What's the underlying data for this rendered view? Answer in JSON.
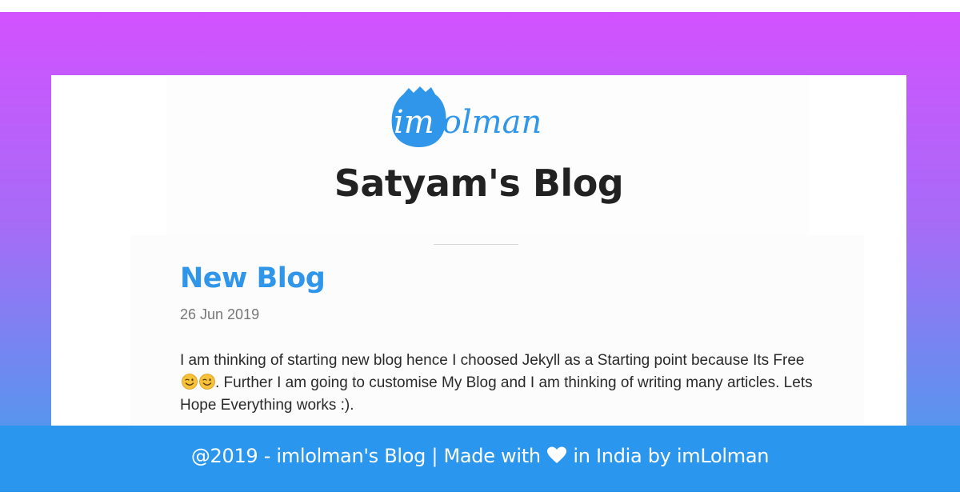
{
  "brand": {
    "logo_text": "imlolman",
    "logo_color": "#2f96ea"
  },
  "site": {
    "title": "Satyam's Blog"
  },
  "post": {
    "title": "New Blog",
    "date": "26 Jun 2019",
    "body_part1": "I am thinking of starting new blog hence I choosed Jekyll as a Starting point because Its Free ",
    "emoji_icons": [
      "winking-face-icon",
      "winking-face-icon"
    ],
    "body_part2": ". Further I am going to customise My Blog and I am thinking of writing many articles. Lets Hope Everything works :)."
  },
  "footer": {
    "text_before_icon": "@2019 - imlolman's Blog | Made with ",
    "icon": "heart-icon",
    "text_after_icon": " in India by imLolman"
  },
  "colors": {
    "gradient_top": "#d352ff",
    "gradient_bottom": "#3a9ef0",
    "footer_bg": "#2a96ee",
    "link_blue": "#2f96ea"
  }
}
